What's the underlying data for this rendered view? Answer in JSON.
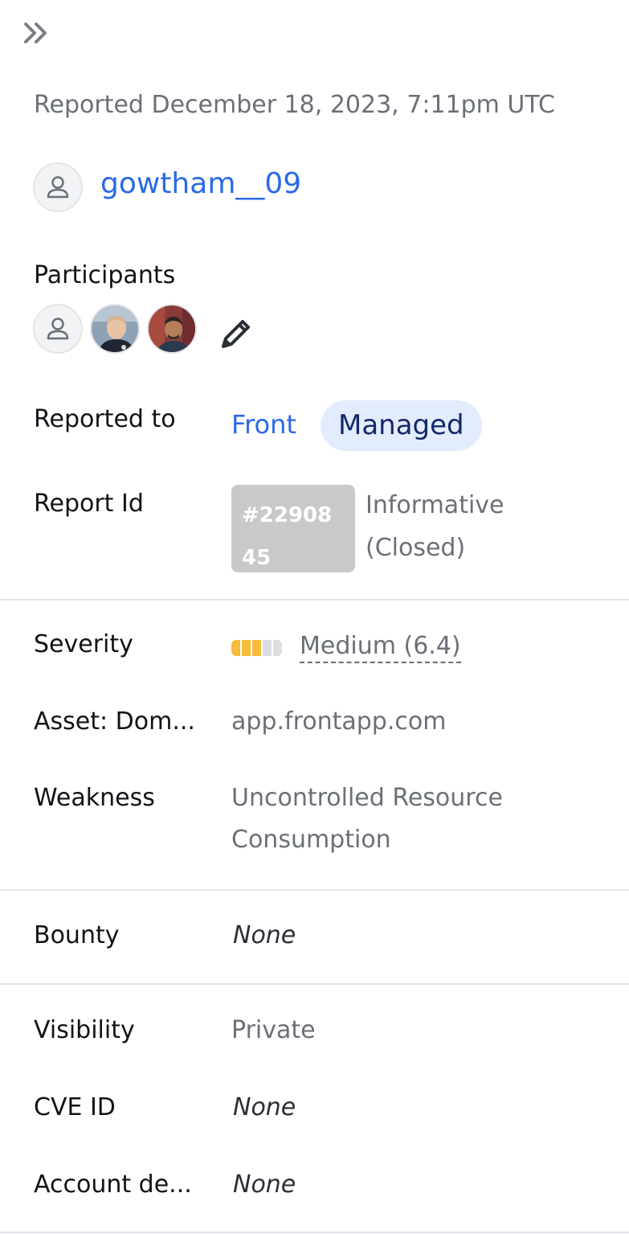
{
  "header": {
    "expand_icon": "double-chevron-right-icon",
    "reported_date": "Reported December 18, 2023, 7:11pm UTC"
  },
  "reporter": {
    "avatar_icon": "person-icon",
    "username": "gowtham__09",
    "link_color": "#2a6ae6"
  },
  "participants": {
    "label": "Participants",
    "edit_icon": "pencil-icon"
  },
  "reported_to": {
    "label": "Reported to",
    "program": "Front",
    "badge": "Managed"
  },
  "report_id": {
    "label": "Report Id",
    "id": "#2290845",
    "status_line1": "Informative",
    "status_line2": "(Closed)"
  },
  "severity": {
    "label": "Severity",
    "value": "Medium (6.4)",
    "level_filled": 3,
    "level_total": 5,
    "color": "#f7bb3b"
  },
  "asset": {
    "label": "Asset: Dom...",
    "value": "app.frontapp.com"
  },
  "weakness": {
    "label": "Weakness",
    "value_line1": "Uncontrolled Resource",
    "value_line2": "Consumption"
  },
  "bounty": {
    "label": "Bounty",
    "value": "None"
  },
  "visibility": {
    "label": "Visibility",
    "value": "Private"
  },
  "cve": {
    "label": "CVE ID",
    "value": "None"
  },
  "account": {
    "label": "Account de...",
    "value": "None"
  }
}
